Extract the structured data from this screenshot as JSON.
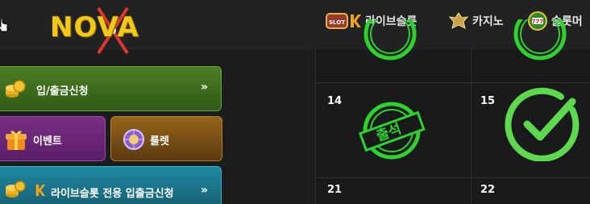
{
  "header": {
    "logo": {
      "text": "NOVA",
      "icon": "nova-x-logo"
    },
    "nav": [
      {
        "label": "라이브슬롯",
        "icon": "slot-k-icon"
      },
      {
        "label": "카지노",
        "icon": "casino-crest-icon"
      },
      {
        "label": "슬롯머",
        "icon": "slot-777-icon"
      }
    ]
  },
  "sidebar": {
    "deposit": {
      "label": "입/출금신청",
      "icon": "coins-icon",
      "chevron": "»"
    },
    "event": {
      "label": "이벤트",
      "icon": "gift-icon"
    },
    "roulette": {
      "label": "룰렛",
      "icon": "roulette-icon"
    },
    "live_slot": {
      "label": "라이브슬롯 전용 입출금신청",
      "icon": "coins-k-icon",
      "chevron": "»"
    }
  },
  "calendar": {
    "days": [
      "14",
      "15",
      "21",
      "22"
    ],
    "stamp_text": "출석"
  },
  "colors": {
    "green_btn": "#3f6f1c",
    "purple_btn": "#6d2a7a",
    "orange_btn": "#8a5a12",
    "teal_btn": "#1b6f86",
    "stamp_green": "#2fd12f",
    "check_green": "#5ed94f"
  }
}
